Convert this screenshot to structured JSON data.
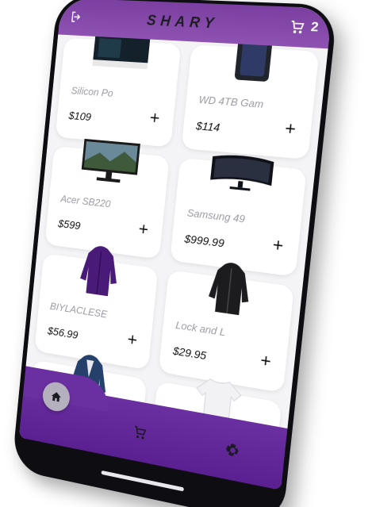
{
  "app": {
    "title": "SHARY",
    "cart_count": "2"
  },
  "products": [
    {
      "name": "Silicon Po",
      "price": "$109",
      "add_label": "+",
      "thumb": "ssd-icon"
    },
    {
      "name": "WD 4TB Gam",
      "price": "$114",
      "add_label": "+",
      "thumb": "hard-drive-icon"
    },
    {
      "name": "Acer SB220",
      "price": "$599",
      "add_label": "+",
      "thumb": "monitor-icon"
    },
    {
      "name": "Samsung 49",
      "price": "$999.99",
      "add_label": "+",
      "thumb": "curved-monitor-icon"
    },
    {
      "name": "BIYLACLESE",
      "price": "$56.99",
      "add_label": "+",
      "thumb": "purple-jacket-icon"
    },
    {
      "name": "Lock and L",
      "price": "$29.95",
      "add_label": "+",
      "thumb": "black-jacket-icon"
    },
    {
      "name": "",
      "price": "",
      "add_label": "",
      "thumb": "blue-jacket-icon"
    },
    {
      "name": "",
      "price": "",
      "add_label": "",
      "thumb": "white-top-icon"
    }
  ],
  "colors": {
    "accent": "#7a3fa0",
    "nav": "#5a1f90",
    "home_bubble": "#b5b0bd"
  },
  "nav": {
    "active": "home"
  }
}
